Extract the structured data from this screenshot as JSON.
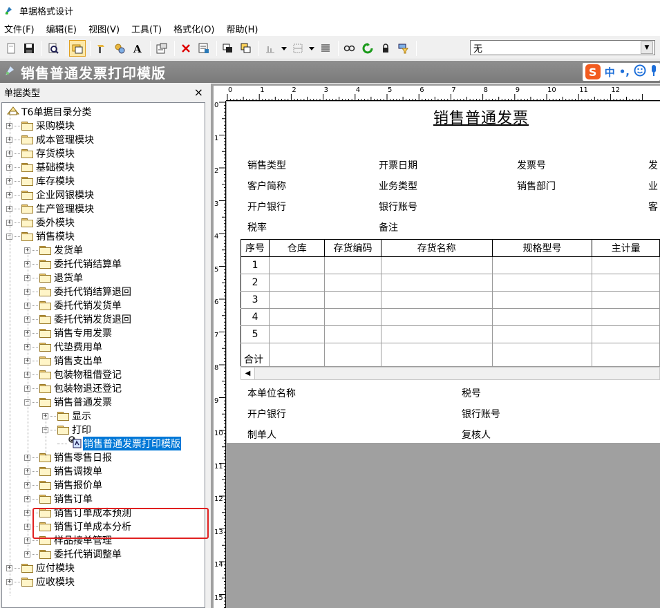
{
  "window": {
    "title": "单据格式设计"
  },
  "menu": [
    "文件(F)",
    "编辑(E)",
    "视图(V)",
    "工具(T)",
    "格式化(O)",
    "帮助(H)"
  ],
  "toolbar": {
    "icons": [
      "new-icon",
      "save-icon",
      "preview-icon",
      "sep",
      "select-icon",
      "sep",
      "format-icon",
      "paint-icon",
      "font-icon",
      "sep",
      "properties-icon",
      "sep",
      "delete-icon",
      "table-icon",
      "sep",
      "copy-icon",
      "paste-icon",
      "sep",
      "align-icon",
      "line-style-icon",
      "border-icon",
      "justify-icon",
      "sep",
      "link-icon",
      "refresh-icon",
      "lock-icon",
      "filter-icon"
    ],
    "combo_value": "无"
  },
  "doc_header": {
    "title": "销售普通发票打印模版"
  },
  "ime": {
    "logo": "S",
    "mode": "中",
    "punct": "•,"
  },
  "left_panel": {
    "title": "单据类型",
    "close": "×",
    "tree": {
      "root": "T6单据目录分类",
      "top_modules": [
        "采购模块",
        "成本管理模块",
        "存货模块",
        "基础模块",
        "库存模块",
        "企业网银模块",
        "生产管理模块",
        "委外模块"
      ],
      "sales_module": "销售模块",
      "sales_children_before": [
        "发货单",
        "委托代销结算单",
        "退货单",
        "委托代销结算退回",
        "委托代销发货单",
        "委托代销发货退回",
        "销售专用发票",
        "代垫费用单",
        "销售支出单",
        "包装物租借登记",
        "包装物退还登记"
      ],
      "ordinary_invoice": "销售普通发票",
      "display": "显示",
      "print": "打印",
      "selected_template": "销售普通发票打印模版",
      "sales_children_after": [
        "销售零售日报",
        "销售调拨单",
        "销售报价单",
        "销售订单",
        "销售订单成本预测",
        "销售订单成本分析",
        "样品接单管理",
        "委托代销调整单"
      ],
      "bottom_modules": [
        "应付模块",
        "应收模块"
      ]
    }
  },
  "ruler": {
    "top": [
      "0",
      "1",
      "2",
      "3",
      "4",
      "5",
      "6",
      "7",
      "8",
      "9",
      "10",
      "11",
      "12"
    ],
    "left": [
      "0",
      "1",
      "2",
      "3",
      "4",
      "5",
      "6",
      "7",
      "8",
      "9",
      "10",
      "11",
      "12",
      "13",
      "14",
      "15"
    ]
  },
  "invoice": {
    "title": "销售普通发票",
    "header_fields": [
      [
        "销售类型",
        "开票日期",
        "发票号",
        "发"
      ],
      [
        "客户简称",
        "业务类型",
        "销售部门",
        "业"
      ],
      [
        "开户银行",
        "银行账号",
        "",
        "客"
      ],
      [
        "税率",
        "备注",
        "",
        ""
      ]
    ],
    "columns": [
      "序号",
      "仓库",
      "存货编码",
      "存货名称",
      "规格型号",
      "主计量"
    ],
    "row_numbers": [
      "1",
      "2",
      "3",
      "4",
      "5"
    ],
    "total_label": "合计",
    "footer_fields": [
      [
        "本单位名称",
        "税号"
      ],
      [
        "开户银行",
        "银行账号"
      ],
      [
        "制单人",
        "复核人"
      ]
    ]
  }
}
